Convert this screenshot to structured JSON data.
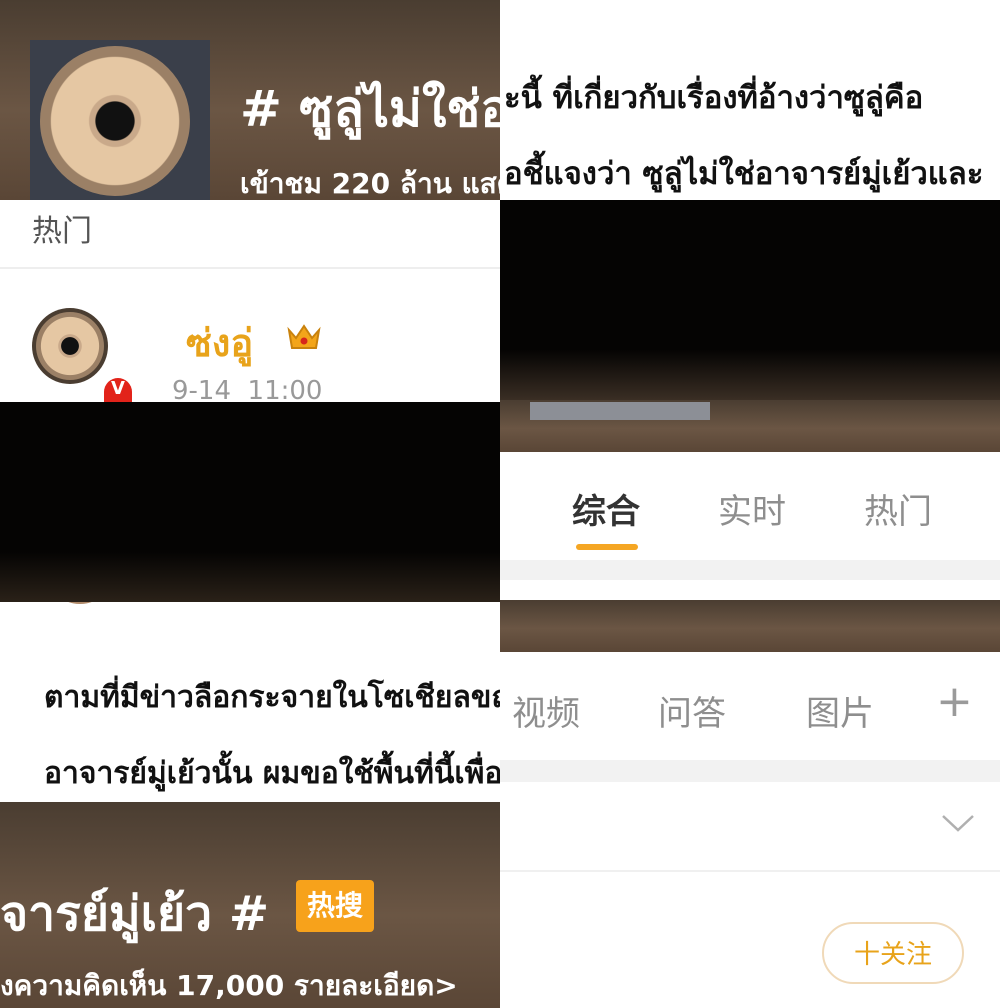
{
  "topic": {
    "title_fragment": "# ซูลู่ไม่ใช่อ",
    "stats_fragment": "เข้าชม 220 ล้าน แสด",
    "title_end": "จารย์มู่เย้ว #",
    "hot_badge": "热搜",
    "stats_end": "งความคิดเห็น 17,000 รายละเอียด>"
  },
  "post": {
    "heading_right_1": "ะนี้ ที่เกี่ยวกับเรื่องที่อ้างว่าซูลู่คือ",
    "heading_right_2": "อชี้แจงว่า ซูลู่ไม่ใช่อาจารย์มู่เย้วและ",
    "section_label": "热门",
    "author_name": "ซ่งอู่",
    "timestamp": "9-14  11:00",
    "body_line_1": "ตามที่มีข่าวลือกระจายในโซเชียลขณ",
    "body_line_2": "อาจารย์มู่เย้วนั้น ผมขอใช้พื้นที่นี้เพื่อ",
    "follow_button": "十关注"
  },
  "tabs_row_1": [
    "综合",
    "实时",
    "热门"
  ],
  "tabs_row_2": [
    "视频",
    "问答",
    "图片"
  ],
  "icons": {
    "plus": "+",
    "chevron": "chevron-down-icon",
    "crown": "crown-icon",
    "verified": "V"
  },
  "colors": {
    "accent": "#f5a623",
    "author": "#e8a31a",
    "badge_bg": "#f7a21b"
  }
}
